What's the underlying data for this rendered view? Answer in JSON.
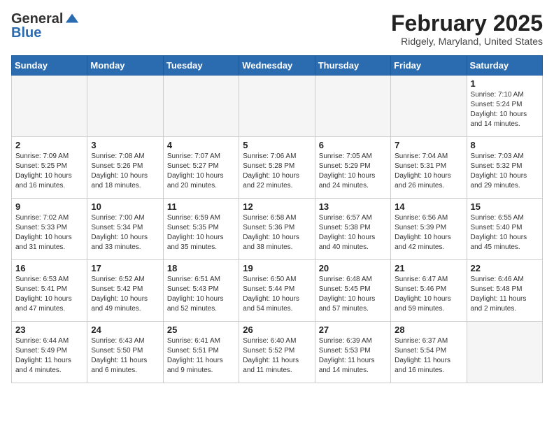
{
  "header": {
    "logo_general": "General",
    "logo_blue": "Blue",
    "month_title": "February 2025",
    "subtitle": "Ridgely, Maryland, United States"
  },
  "days_of_week": [
    "Sunday",
    "Monday",
    "Tuesday",
    "Wednesday",
    "Thursday",
    "Friday",
    "Saturday"
  ],
  "weeks": [
    [
      {
        "day": "",
        "info": ""
      },
      {
        "day": "",
        "info": ""
      },
      {
        "day": "",
        "info": ""
      },
      {
        "day": "",
        "info": ""
      },
      {
        "day": "",
        "info": ""
      },
      {
        "day": "",
        "info": ""
      },
      {
        "day": "1",
        "info": "Sunrise: 7:10 AM\nSunset: 5:24 PM\nDaylight: 10 hours\nand 14 minutes."
      }
    ],
    [
      {
        "day": "2",
        "info": "Sunrise: 7:09 AM\nSunset: 5:25 PM\nDaylight: 10 hours\nand 16 minutes."
      },
      {
        "day": "3",
        "info": "Sunrise: 7:08 AM\nSunset: 5:26 PM\nDaylight: 10 hours\nand 18 minutes."
      },
      {
        "day": "4",
        "info": "Sunrise: 7:07 AM\nSunset: 5:27 PM\nDaylight: 10 hours\nand 20 minutes."
      },
      {
        "day": "5",
        "info": "Sunrise: 7:06 AM\nSunset: 5:28 PM\nDaylight: 10 hours\nand 22 minutes."
      },
      {
        "day": "6",
        "info": "Sunrise: 7:05 AM\nSunset: 5:29 PM\nDaylight: 10 hours\nand 24 minutes."
      },
      {
        "day": "7",
        "info": "Sunrise: 7:04 AM\nSunset: 5:31 PM\nDaylight: 10 hours\nand 26 minutes."
      },
      {
        "day": "8",
        "info": "Sunrise: 7:03 AM\nSunset: 5:32 PM\nDaylight: 10 hours\nand 29 minutes."
      }
    ],
    [
      {
        "day": "9",
        "info": "Sunrise: 7:02 AM\nSunset: 5:33 PM\nDaylight: 10 hours\nand 31 minutes."
      },
      {
        "day": "10",
        "info": "Sunrise: 7:00 AM\nSunset: 5:34 PM\nDaylight: 10 hours\nand 33 minutes."
      },
      {
        "day": "11",
        "info": "Sunrise: 6:59 AM\nSunset: 5:35 PM\nDaylight: 10 hours\nand 35 minutes."
      },
      {
        "day": "12",
        "info": "Sunrise: 6:58 AM\nSunset: 5:36 PM\nDaylight: 10 hours\nand 38 minutes."
      },
      {
        "day": "13",
        "info": "Sunrise: 6:57 AM\nSunset: 5:38 PM\nDaylight: 10 hours\nand 40 minutes."
      },
      {
        "day": "14",
        "info": "Sunrise: 6:56 AM\nSunset: 5:39 PM\nDaylight: 10 hours\nand 42 minutes."
      },
      {
        "day": "15",
        "info": "Sunrise: 6:55 AM\nSunset: 5:40 PM\nDaylight: 10 hours\nand 45 minutes."
      }
    ],
    [
      {
        "day": "16",
        "info": "Sunrise: 6:53 AM\nSunset: 5:41 PM\nDaylight: 10 hours\nand 47 minutes."
      },
      {
        "day": "17",
        "info": "Sunrise: 6:52 AM\nSunset: 5:42 PM\nDaylight: 10 hours\nand 49 minutes."
      },
      {
        "day": "18",
        "info": "Sunrise: 6:51 AM\nSunset: 5:43 PM\nDaylight: 10 hours\nand 52 minutes."
      },
      {
        "day": "19",
        "info": "Sunrise: 6:50 AM\nSunset: 5:44 PM\nDaylight: 10 hours\nand 54 minutes."
      },
      {
        "day": "20",
        "info": "Sunrise: 6:48 AM\nSunset: 5:45 PM\nDaylight: 10 hours\nand 57 minutes."
      },
      {
        "day": "21",
        "info": "Sunrise: 6:47 AM\nSunset: 5:46 PM\nDaylight: 10 hours\nand 59 minutes."
      },
      {
        "day": "22",
        "info": "Sunrise: 6:46 AM\nSunset: 5:48 PM\nDaylight: 11 hours\nand 2 minutes."
      }
    ],
    [
      {
        "day": "23",
        "info": "Sunrise: 6:44 AM\nSunset: 5:49 PM\nDaylight: 11 hours\nand 4 minutes."
      },
      {
        "day": "24",
        "info": "Sunrise: 6:43 AM\nSunset: 5:50 PM\nDaylight: 11 hours\nand 6 minutes."
      },
      {
        "day": "25",
        "info": "Sunrise: 6:41 AM\nSunset: 5:51 PM\nDaylight: 11 hours\nand 9 minutes."
      },
      {
        "day": "26",
        "info": "Sunrise: 6:40 AM\nSunset: 5:52 PM\nDaylight: 11 hours\nand 11 minutes."
      },
      {
        "day": "27",
        "info": "Sunrise: 6:39 AM\nSunset: 5:53 PM\nDaylight: 11 hours\nand 14 minutes."
      },
      {
        "day": "28",
        "info": "Sunrise: 6:37 AM\nSunset: 5:54 PM\nDaylight: 11 hours\nand 16 minutes."
      },
      {
        "day": "",
        "info": ""
      }
    ]
  ]
}
